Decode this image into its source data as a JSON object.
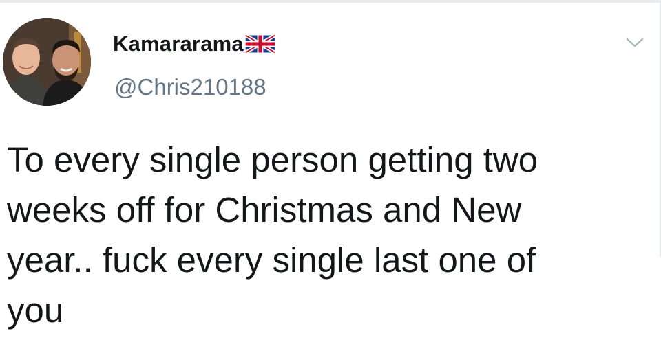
{
  "author": {
    "display_name": "Kamararama",
    "handle": "@Chris210188",
    "name_emoji_icon": "uk-flag-icon",
    "avatar_icon": "profile-photo-two-men"
  },
  "tweet": {
    "text": "To every single person getting two\nweeks off for Christmas and New\nyear.. fuck every single last one of\nyou"
  },
  "controls": {
    "menu_icon": "chevron-down-icon"
  },
  "colors": {
    "text": "#14171a",
    "secondary_text": "#657786",
    "caret": "#aab8c2",
    "divider": "#e6ecf0"
  }
}
